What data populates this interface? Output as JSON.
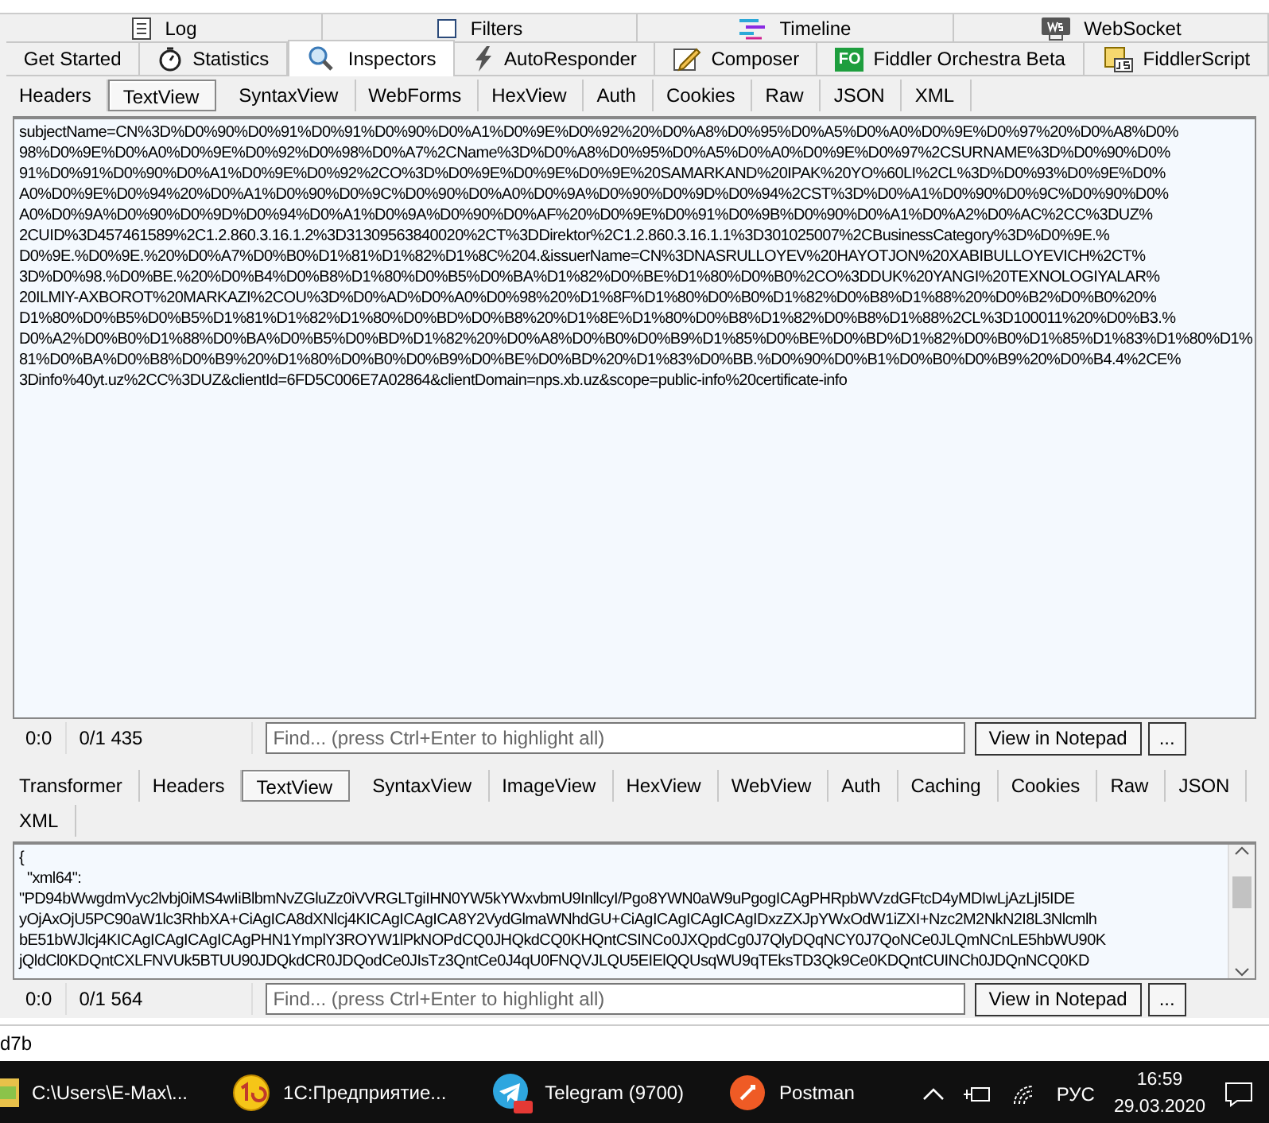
{
  "top_tabs": [
    {
      "label": "Log",
      "selected": false
    },
    {
      "label": "Filters",
      "selected": false
    },
    {
      "label": "Timeline",
      "selected": false
    },
    {
      "label": "WebSocket",
      "selected": false
    }
  ],
  "main_tabs": [
    {
      "label": "Get Started",
      "selected": false
    },
    {
      "label": "Statistics",
      "selected": false
    },
    {
      "label": "Inspectors",
      "selected": true
    },
    {
      "label": "AutoResponder",
      "selected": false
    },
    {
      "label": "Composer",
      "selected": false
    },
    {
      "label": "Fiddler Orchestra Beta",
      "badge": "FO",
      "selected": false
    },
    {
      "label": "FiddlerScript",
      "selected": false
    }
  ],
  "request": {
    "tabs": [
      {
        "label": "Headers",
        "selected": false
      },
      {
        "label": "TextView",
        "selected": true
      },
      {
        "label": "SyntaxView",
        "selected": false
      },
      {
        "label": "WebForms",
        "selected": false
      },
      {
        "label": "HexView",
        "selected": false
      },
      {
        "label": "Auth",
        "selected": false
      },
      {
        "label": "Cookies",
        "selected": false
      },
      {
        "label": "Raw",
        "selected": false
      },
      {
        "label": "JSON",
        "selected": false
      },
      {
        "label": "XML",
        "selected": false
      }
    ],
    "text_lines": [
      "subjectName=CN%3D%D0%90%D0%91%D0%91%D0%90%D0%A1%D0%9E%D0%92%20%D0%A8%D0%95%D0%A5%D0%A0%D0%9E%D0%97%20%D0%A8%D0%",
      "98%D0%9E%D0%A0%D0%9E%D0%92%D0%98%D0%A7%2CName%3D%D0%A8%D0%95%D0%A5%D0%A0%D0%9E%D0%97%2CSURNAME%3D%D0%90%D0%",
      "91%D0%91%D0%90%D0%A1%D0%9E%D0%92%2CO%3D%D0%9E%D0%9E%D0%9E%20SAMARKAND%20IPAK%20YO%60LI%2CL%3D%D0%93%D0%9E%D0%",
      "A0%D0%9E%D0%94%20%D0%A1%D0%90%D0%9C%D0%90%D0%A0%D0%9A%D0%90%D0%9D%D0%94%2CST%3D%D0%A1%D0%90%D0%9C%D0%90%D0%",
      "A0%D0%9A%D0%90%D0%9D%D0%94%D0%A1%D0%9A%D0%90%D0%AF%20%D0%9E%D0%91%D0%9B%D0%90%D0%A1%D0%A2%D0%AC%2CC%3DUZ%",
      "2CUID%3D457461589%2C1.2.860.3.16.1.2%3D31309563840020%2CT%3DDirektor%2C1.2.860.3.16.1.1%3D301025007%2CBusinessCategory%3D%D0%9E.%",
      "D0%9E.%D0%9E.%20%D0%A7%D0%B0%D1%81%D1%82%D1%8C%204.&issuerName=CN%3DNASRULLOYEV%20HAYOTJON%20XABIBULLOYEVICH%2CT%",
      "3D%D0%98.%D0%BE.%20%D0%B4%D0%B8%D1%80%D0%B5%D0%BA%D1%82%D0%BE%D1%80%D0%B0%2CO%3DDUK%20YANGI%20TEXNOLOGIYALAR%",
      "20ILMIY-AXBOROT%20MARKAZI%2COU%3D%D0%AD%D0%A0%D0%98%20%D1%8F%D1%80%D0%B0%D1%82%D0%B8%D1%88%20%D0%B2%D0%B0%20%",
      "D1%80%D0%B5%D0%B5%D1%81%D1%82%D1%80%D0%BD%D0%B8%20%D1%8E%D1%80%D0%B8%D1%82%D0%B8%D1%88%2CL%3D100011%20%D0%B3.%",
      "D0%A2%D0%B0%D1%88%D0%BA%D0%B5%D0%BD%D1%82%20%D0%A8%D0%B0%D0%B9%D1%85%D0%BE%D0%BD%D1%82%D0%B0%D1%85%D1%83%D1%80%D1%",
      "81%D0%BA%D0%B8%D0%B9%20%D1%80%D0%B0%D0%B9%D0%BE%D0%BD%20%D1%83%D0%BB.%D0%90%D0%B1%D0%B0%D0%B9%20%D0%B4.4%2CE%",
      "3Dinfo%40yt.uz%2CC%3DUZ&clientId=6FD5C006E7A02864&clientDomain=nps.xb.uz&scope=public-info%20certificate-info"
    ],
    "status": {
      "position": "0:0",
      "count": "0/1 435",
      "find_placeholder": "Find... (press Ctrl+Enter to highlight all)",
      "notepad_button": "View in Notepad",
      "more_button": "..."
    }
  },
  "response": {
    "tabs": [
      {
        "label": "Transformer",
        "selected": false
      },
      {
        "label": "Headers",
        "selected": false
      },
      {
        "label": "TextView",
        "selected": true
      },
      {
        "label": "SyntaxView",
        "selected": false
      },
      {
        "label": "ImageView",
        "selected": false
      },
      {
        "label": "HexView",
        "selected": false
      },
      {
        "label": "WebView",
        "selected": false
      },
      {
        "label": "Auth",
        "selected": false
      },
      {
        "label": "Caching",
        "selected": false
      },
      {
        "label": "Cookies",
        "selected": false
      },
      {
        "label": "Raw",
        "selected": false
      },
      {
        "label": "JSON",
        "selected": false
      },
      {
        "label": "XML",
        "selected": false
      }
    ],
    "text_lines": [
      "{",
      "  \"xml64\":",
      "\"PD94bWwgdmVyc2lvbj0iMS4wIiBlbmNvZGluZz0iVVRGLTgiIHN0YW5kYWxvbmU9InllcyI/Pgo8YWN0aW9uPgogICAgPHRpbWVzdGFtcD4yMDIwLjAzLjI5IDE",
      "yOjAxOjU5PC90aW1lc3RhbXA+CiAgICA8dXNlcj4KICAgICAgICA8Y2VydGlmaWNhdGU+CiAgICAgICAgICAgIDxzZXJpYWxOdW1iZXI+Nzc2M2NkN2I8L3Nlcmlh",
      "bE51bWJlcj4KICAgICAgICAgICAgPHN1YmplY3ROYW1lPkNOPdCQ0JHQkdCQ0KHQntCSINCo0JXQpdCg0J7QlyDQqNCY0J7QoNCe0JLQmNCnLE5hbWU90K",
      "jQldCl0KDQntCXLFNVUk5BTUU90JDQkdCR0JDQodCe0JIsTz3QntCe0J4qU0FNQVJLQU5EIElQQUsqWU9qTEksTD3Qk9Ce0KDQntCUINCh0JDQnNCQ0KD"
    ],
    "status": {
      "position": "0:0",
      "count": "0/1 564",
      "find_placeholder": "Find... (press Ctrl+Enter to highlight all)",
      "notepad_button": "View in Notepad",
      "more_button": "..."
    }
  },
  "status_text": "d7b",
  "taskbar": {
    "items": [
      {
        "label": "C:\\Users\\E-Max\\..."
      },
      {
        "label": "1С:Предприятие..."
      },
      {
        "label": "Telegram (9700)"
      },
      {
        "label": "Postman"
      }
    ],
    "language": "РУС",
    "time": "16:59",
    "date": "29.03.2020"
  }
}
